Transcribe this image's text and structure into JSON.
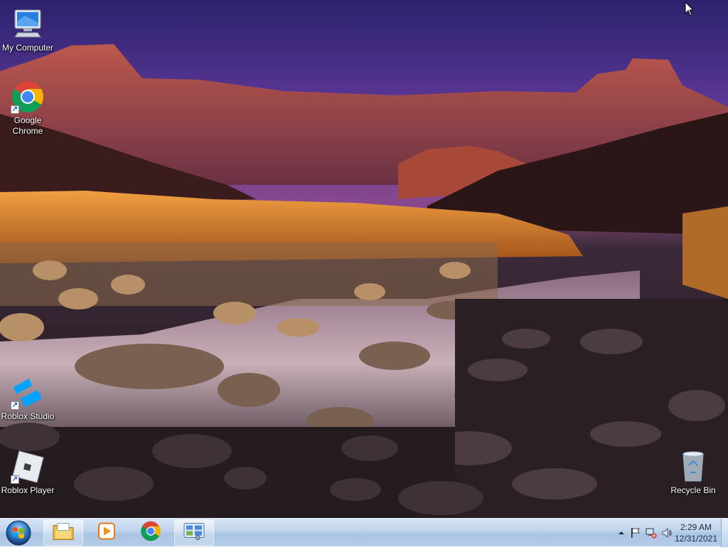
{
  "desktop": {
    "icons": [
      {
        "label": "My Computer",
        "icon": "computer-icon"
      },
      {
        "label": "Google Chrome",
        "icon": "chrome-icon",
        "shortcut": true
      },
      {
        "label": "Roblox Studio",
        "icon": "roblox-studio-icon",
        "shortcut": true
      },
      {
        "label": "Roblox Player",
        "icon": "roblox-player-icon",
        "shortcut": true
      },
      {
        "label": "Recycle Bin",
        "icon": "recycle-bin-icon"
      }
    ]
  },
  "taskbar": {
    "start": {
      "icon": "windows-start-icon"
    },
    "pinned": [
      {
        "icon": "file-explorer-icon"
      },
      {
        "icon": "media-player-icon"
      },
      {
        "icon": "chrome-icon"
      },
      {
        "icon": "control-panel-icon"
      }
    ],
    "tray": {
      "icons": [
        "show-hidden-icons-chevron",
        "action-center-flag-icon",
        "network-icon",
        "volume-icon"
      ],
      "time": "2:29 AM",
      "date": "12/31/2021"
    }
  },
  "colors": {
    "taskbar": "#bcd3ec",
    "sky_top": "#2e2470",
    "grass": "#e08a2a"
  }
}
